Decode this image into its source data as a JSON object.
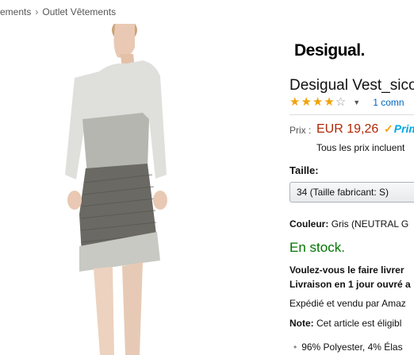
{
  "breadcrumb": {
    "prev": "ements",
    "separator": "›",
    "current": "Outlet Vêtements"
  },
  "product": {
    "brand": "Desigual.",
    "title": "Desigual Vest_sico",
    "rating_stars": 3.5,
    "review_link": "1 comn",
    "price_label": "Prix :",
    "price": "EUR 19,26",
    "prime_label": "Prim",
    "tax_note": "Tous les prix incluent",
    "size_label": "Taille:",
    "size_selected": "34 (Taille fabricant: S)",
    "color_key": "Couleur:",
    "color_value": "Gris (NEUTRAL G",
    "stock": "En stock.",
    "delivery_line1": "Voulez-vous le faire livrer",
    "delivery_line2": "Livraison en 1 jour ouvré a",
    "shipped_by": "Expédié et vendu par Amaz",
    "note_key": "Note:",
    "note_text": "Cet article est éligibl",
    "bullet_1": "96% Polyester, 4% Élas"
  },
  "colors": {
    "price": "#b12704",
    "stock": "#007600",
    "link": "#0066c0",
    "star": "#f0a30a",
    "prime": "#00a8e1"
  },
  "icons": {
    "star": "star-icon",
    "chevron": "chevron-down-icon",
    "prime_check": "check-icon"
  }
}
